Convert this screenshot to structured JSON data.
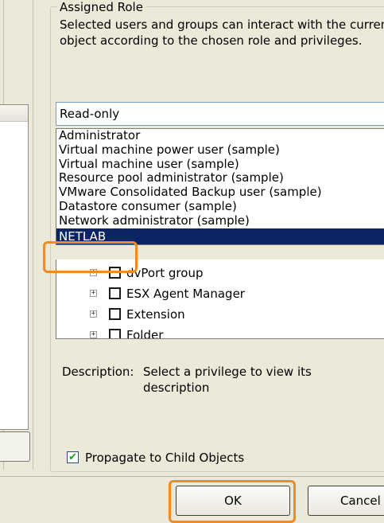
{
  "group": {
    "title": "Assigned Role",
    "description_line1": "Selected users and groups can interact with the curren",
    "description_line2": "object according to the chosen role and privileges."
  },
  "role_select": {
    "value": "Read-only",
    "options": [
      "Administrator",
      "Virtual machine power user (sample)",
      "Virtual machine user (sample)",
      "Resource pool administrator (sample)",
      "VMware Consolidated Backup user (sample)",
      "Datastore consumer (sample)",
      "Network administrator (sample)",
      "NETLAB"
    ],
    "selected": "NETLAB"
  },
  "privilege_tree": {
    "items": [
      {
        "label": "dvPort group",
        "expander": "+"
      },
      {
        "label": "ESX Agent Manager",
        "expander": "+"
      },
      {
        "label": "Extension",
        "expander": "+"
      },
      {
        "label": "Folder",
        "expander": "+"
      }
    ]
  },
  "description": {
    "label": "Description:",
    "text": "Select a privilege to view its description"
  },
  "propagate": {
    "label": "Propagate to Child Objects",
    "checked": true,
    "check_mark": "✔"
  },
  "buttons": {
    "ok": "OK",
    "cancel": "Cancel"
  },
  "colors": {
    "selection_bg": "#0b2466",
    "highlight": "#f08a24",
    "window_bg": "#ece9d8"
  }
}
